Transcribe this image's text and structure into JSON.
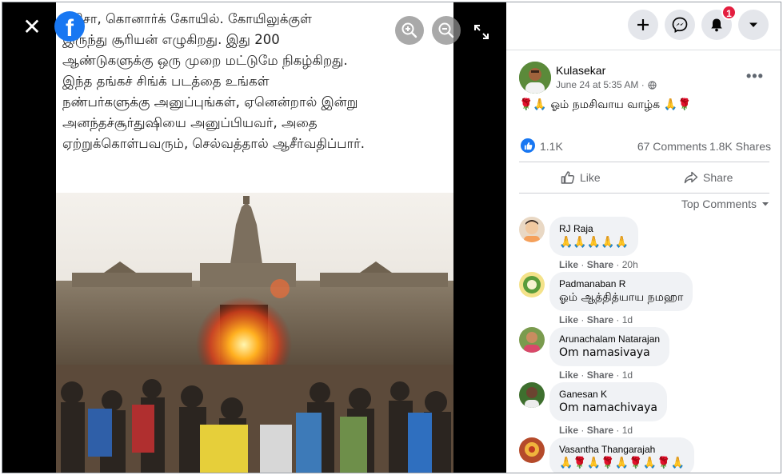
{
  "viewer": {
    "caption_lines": [
      "ஒரிசா, கொனார்க் கோயில். கோயிலுக்குள்",
      "இருந்து சூரியன் எழுகிறது. இது 200",
      "ஆண்டுகளுக்கு ஒரு முறை மட்டுமே நிகழ்கிறது.",
      "இந்த தங்கச் சிங்க் படத்தை உங்கள்",
      "நண்பர்களுக்கு அனுப்புங்கள், ஏனென்றால் இன்று",
      "அனந்தச்சூர்துஷியை அனுப்பியவர், அதை",
      "ஏற்றுக்கொள்பவரும், செல்வத்தால் ஆசீர்வதிப்பார்."
    ],
    "logo_letter": "f",
    "close_glyph": "✕"
  },
  "top_bar": {
    "notification_count": "1"
  },
  "post": {
    "author": "Kulasekar",
    "time": "June 24 at 5:35 AM ·",
    "more_glyph": "•••",
    "text": "🌹🙏 ஓம் நமசிவாய வாழ்க 🙏🌹",
    "likes": "1.1K",
    "comments": "67 Comments",
    "shares": "1.8K Shares",
    "like_label": "Like",
    "share_label": "Share",
    "top_comments_label": "Top Comments"
  },
  "comments": [
    {
      "name": "RJ Raja",
      "text": "🙏🙏🙏🙏🙏",
      "like": "Like",
      "share": "Share",
      "time": "20h"
    },
    {
      "name": "Padmanaban R",
      "text": "ஓம் ஆத்தித்யாய நமஹா",
      "like": "Like",
      "share": "Share",
      "time": "1d"
    },
    {
      "name": "Arunachalam Natarajan",
      "text": "Om namasivaya",
      "like": "Like",
      "share": "Share",
      "time": "1d"
    },
    {
      "name": "Ganesan K",
      "text": "Om namachivaya",
      "like": "Like",
      "share": "Share",
      "time": "1d"
    },
    {
      "name": "Vasantha Thangarajah",
      "text": "🙏🌹🙏🌹🙏🌹🙏🌹🙏",
      "like": "",
      "share": "",
      "time": ""
    }
  ],
  "colors": {
    "accent": "#1877f2",
    "badge": "#e41e3f",
    "bubble": "#f0f2f5"
  }
}
